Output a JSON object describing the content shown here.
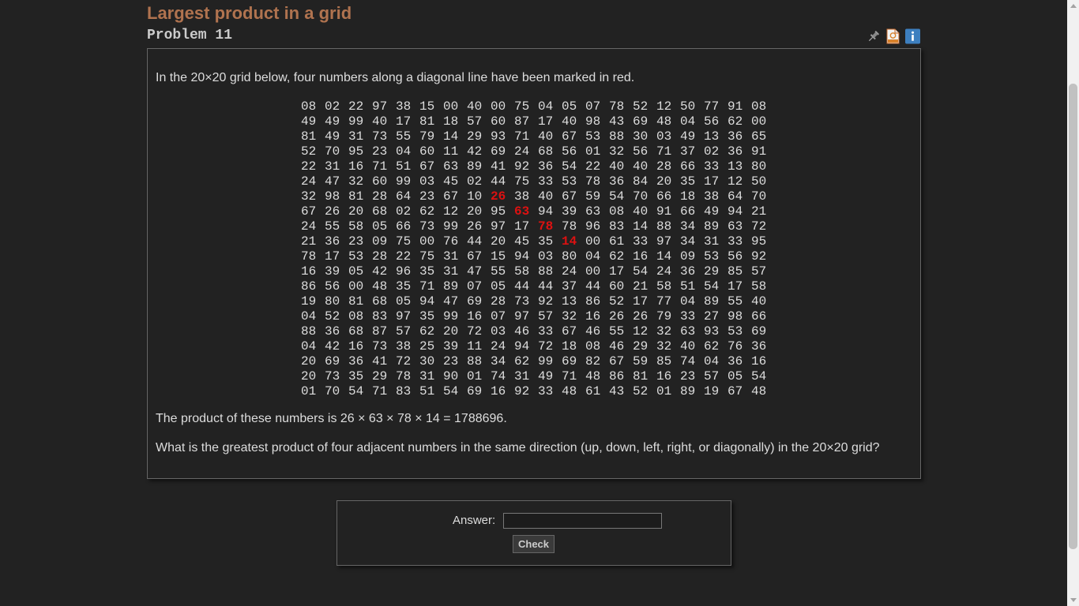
{
  "header": {
    "title": "Largest product in a grid",
    "problem_label": "Problem 11"
  },
  "icons": [
    {
      "name": "pin-icon"
    },
    {
      "name": "html-file-icon"
    },
    {
      "name": "info-icon"
    }
  ],
  "content": {
    "intro": "In the 20×20 grid below, four numbers along a diagonal line have been marked in red.",
    "product_text": "The product of these numbers is 26 × 63 × 78 × 14 = 1788696.",
    "question": "What is the greatest product of four adjacent numbers in the same direction (up, down, left, right, or diagonally) in the 20×20 grid?",
    "highlight_color": "#dd1111",
    "highlighted_cells": [
      [
        6,
        8
      ],
      [
        7,
        9
      ],
      [
        8,
        10
      ],
      [
        9,
        11
      ]
    ],
    "grid": [
      "08 02 22 97 38 15 00 40 00 75 04 05 07 78 52 12 50 77 91 08",
      "49 49 99 40 17 81 18 57 60 87 17 40 98 43 69 48 04 56 62 00",
      "81 49 31 73 55 79 14 29 93 71 40 67 53 88 30 03 49 13 36 65",
      "52 70 95 23 04 60 11 42 69 24 68 56 01 32 56 71 37 02 36 91",
      "22 31 16 71 51 67 63 89 41 92 36 54 22 40 40 28 66 33 13 80",
      "24 47 32 60 99 03 45 02 44 75 33 53 78 36 84 20 35 17 12 50",
      "32 98 81 28 64 23 67 10 26 38 40 67 59 54 70 66 18 38 64 70",
      "67 26 20 68 02 62 12 20 95 63 94 39 63 08 40 91 66 49 94 21",
      "24 55 58 05 66 73 99 26 97 17 78 78 96 83 14 88 34 89 63 72",
      "21 36 23 09 75 00 76 44 20 45 35 14 00 61 33 97 34 31 33 95",
      "78 17 53 28 22 75 31 67 15 94 03 80 04 62 16 14 09 53 56 92",
      "16 39 05 42 96 35 31 47 55 58 88 24 00 17 54 24 36 29 85 57",
      "86 56 00 48 35 71 89 07 05 44 44 37 44 60 21 58 51 54 17 58",
      "19 80 81 68 05 94 47 69 28 73 92 13 86 52 17 77 04 89 55 40",
      "04 52 08 83 97 35 99 16 07 97 57 32 16 26 26 79 33 27 98 66",
      "88 36 68 87 57 62 20 72 03 46 33 67 46 55 12 32 63 93 53 69",
      "04 42 16 73 38 25 39 11 24 94 72 18 08 46 29 32 40 62 76 36",
      "20 69 36 41 72 30 23 88 34 62 99 69 82 67 59 85 74 04 36 16",
      "20 73 35 29 78 31 90 01 74 31 49 71 48 86 81 16 23 57 05 54",
      "01 70 54 71 83 51 54 69 16 92 33 48 61 43 52 01 89 19 67 48"
    ]
  },
  "answer_form": {
    "label": "Answer:",
    "input_value": "",
    "check_label": "Check"
  }
}
